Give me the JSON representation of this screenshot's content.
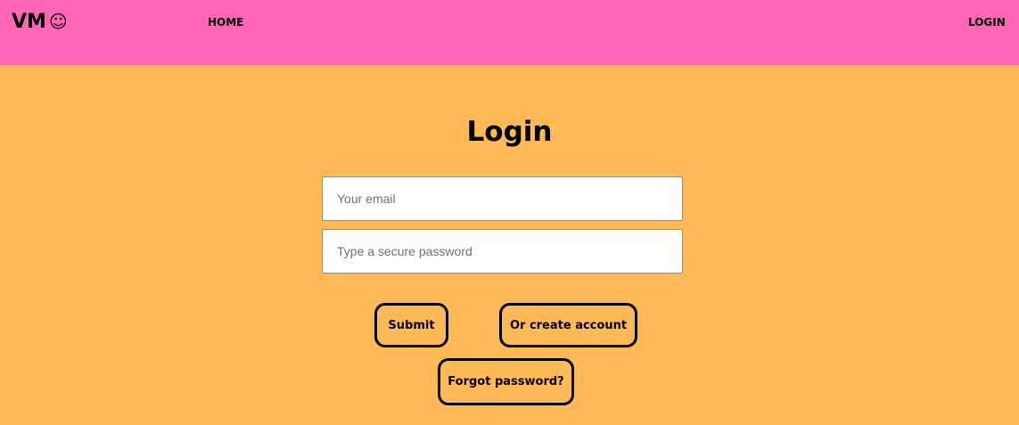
{
  "navbar": {
    "brand": "VM",
    "brand_icon": "☺",
    "home_label": "HOME",
    "login_label": "LOGIN",
    "background_color": "#FF66B6"
  },
  "page": {
    "background_color": "#FFB957"
  },
  "form": {
    "title": "Login",
    "email_placeholder": "Your email",
    "password_placeholder": "Type a secure password",
    "submit_label": "Submit",
    "create_account_label": "Or create account",
    "forgot_password_label": "Forgot password?"
  }
}
